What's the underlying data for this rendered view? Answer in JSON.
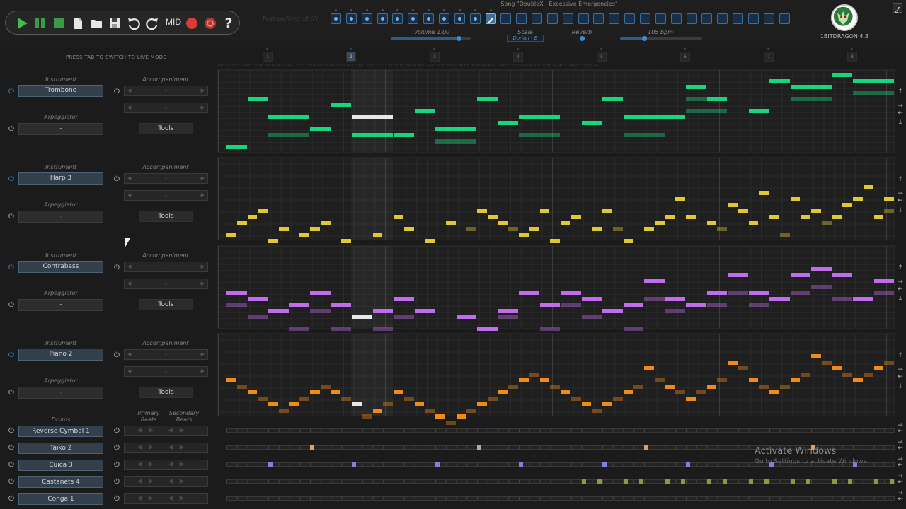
{
  "window": {
    "song_title": "Song \"DoubleX - Excessive Emergencies\"",
    "perf_text": "Post-perform off (F)"
  },
  "toolbar": {
    "mid_label": "MID"
  },
  "controls": {
    "volume_label": "Volume 1.00",
    "volume": 0.85,
    "scale_label": "Scale",
    "scale_value": "Dorian - B",
    "reverb_label": "Reverb",
    "bpm_label": "105 bpm",
    "bpm": 0.29
  },
  "patterns": {
    "count": 30,
    "active": 10,
    "selected": 10
  },
  "logo": {
    "text": "1BITDRAGON 4.3"
  },
  "tab_hint": "PRESS TAB TO SWITCH TO LIVE MODE",
  "markers": [
    "1",
    "2",
    "3",
    "4",
    "5",
    "6",
    "7",
    "8"
  ],
  "ruler": "A4 C5 D5 E5 G5 A5 C6 D6 E6 G6 A6 C7 A4 C5 D5 E5 G5 A5 C6 D6 E6 G6 A6 C7 A4 C5 D5 E5 G5 A5 C6 D6 E6 G6 A6 C7 A4 C5 D5 E5 G5 A5 C6 D6 E6 G6 A6 C7 A4 C5 D5 E5 G5 A5 C6 D6 E6 G6 A6 C7 A4 C5 D5 E5 G5",
  "track_labels": {
    "instrument": "Instrument",
    "accompaniment": "Accompaniment",
    "arpeggiator": "Arpeggiator",
    "tools": "Tools",
    "dash": "-"
  },
  "tracks": [
    {
      "instrument": "Trombone",
      "arp": "-",
      "acc1": "-",
      "acc2": "-"
    },
    {
      "instrument": "Harp 3",
      "arp": "-",
      "acc1": "-",
      "acc2": "-"
    },
    {
      "instrument": "Contrabass",
      "arp": "-",
      "acc1": "-",
      "acc2": "-"
    },
    {
      "instrument": "Piano 2",
      "arp": "-",
      "acc1": "-",
      "acc2": "-"
    }
  ],
  "colors": {
    "t1": "#16d67e",
    "t2": "#e0c832",
    "t3": "#c06cec",
    "t4": "#f08a18",
    "c1": "#d8a070",
    "c2": "#8080e0",
    "c3": "#8a9a3e"
  },
  "drums": {
    "header": "Drums",
    "primary": "Primary Beats",
    "secondary": "Secondary Beats",
    "rows": [
      {
        "name": "Reverse Cymbal 1",
        "hits": []
      },
      {
        "name": "Taiko 2",
        "hits": [
          8,
          24,
          40,
          56
        ],
        "color": "c1"
      },
      {
        "name": "Cuica 3",
        "hits": [
          4,
          12,
          20,
          28,
          36,
          44,
          52,
          60
        ],
        "color": "c2"
      },
      {
        "name": "Castanets 4",
        "hits": [
          34,
          35.5,
          38,
          39.5,
          42,
          43.5,
          46,
          47.5,
          50,
          51.5,
          54,
          55.5,
          58,
          59.5,
          62,
          63.5
        ],
        "color": "c3"
      },
      {
        "name": "Conga 1",
        "hits": []
      }
    ]
  },
  "watermark": {
    "title": "Activate Windows",
    "sub": "Go to Settings to activate Windows."
  },
  "notes": [
    [
      [
        0,
        2,
        12,
        0
      ],
      [
        2,
        2,
        4,
        0
      ],
      [
        4,
        4,
        7,
        0
      ],
      [
        4,
        4,
        10,
        1
      ],
      [
        8,
        2,
        9,
        0
      ],
      [
        10,
        2,
        5,
        0
      ],
      [
        12,
        4,
        7,
        2
      ],
      [
        12,
        4,
        10,
        3
      ],
      [
        16,
        2,
        10,
        0
      ],
      [
        18,
        2,
        6,
        0
      ],
      [
        20,
        4,
        9,
        0
      ],
      [
        20,
        4,
        11,
        1
      ],
      [
        24,
        2,
        4,
        0
      ],
      [
        26,
        2,
        8,
        0
      ],
      [
        28,
        4,
        7,
        0
      ],
      [
        28,
        4,
        10,
        1
      ],
      [
        34,
        2,
        8,
        0
      ],
      [
        36,
        2,
        4,
        0
      ],
      [
        38,
        4,
        7,
        0
      ],
      [
        38,
        4,
        10,
        1
      ],
      [
        42,
        2,
        7,
        0
      ],
      [
        44,
        2,
        2,
        0
      ],
      [
        46,
        2,
        4,
        0
      ],
      [
        44,
        4,
        4,
        1
      ],
      [
        44,
        4,
        6,
        1
      ],
      [
        50,
        2,
        6,
        0
      ],
      [
        52,
        2,
        1,
        0
      ],
      [
        54,
        4,
        2,
        0
      ],
      [
        54,
        4,
        4,
        1
      ],
      [
        58,
        2,
        0,
        0
      ],
      [
        60,
        4,
        1,
        0
      ],
      [
        60,
        4,
        3,
        1
      ]
    ],
    [
      [
        0,
        1,
        12,
        0
      ],
      [
        1,
        1,
        10,
        0
      ],
      [
        2,
        1,
        9,
        0
      ],
      [
        3,
        1,
        8,
        0
      ],
      [
        4,
        1,
        13,
        0
      ],
      [
        5,
        1,
        11,
        0
      ],
      [
        6,
        1,
        15,
        0
      ],
      [
        7,
        1,
        12,
        0
      ],
      [
        8,
        1,
        11,
        0
      ],
      [
        9,
        1,
        10,
        0
      ],
      [
        10,
        1,
        16,
        0
      ],
      [
        11,
        1,
        13,
        0
      ],
      [
        12,
        1,
        17,
        2
      ],
      [
        13,
        1,
        14,
        0
      ],
      [
        14,
        1,
        12,
        0
      ],
      [
        15,
        1,
        14,
        1
      ],
      [
        16,
        1,
        9,
        0
      ],
      [
        17,
        1,
        11,
        0
      ],
      [
        18,
        1,
        16,
        0
      ],
      [
        19,
        1,
        13,
        0
      ],
      [
        20,
        1,
        18,
        0
      ],
      [
        21,
        1,
        10,
        0
      ],
      [
        22,
        1,
        14,
        0
      ],
      [
        23,
        1,
        11,
        1
      ],
      [
        24,
        1,
        8,
        0
      ],
      [
        25,
        1,
        9,
        0
      ],
      [
        26,
        1,
        10,
        0
      ],
      [
        27,
        1,
        11,
        1
      ],
      [
        28,
        1,
        12,
        0
      ],
      [
        29,
        1,
        11,
        0
      ],
      [
        30,
        1,
        8,
        0
      ],
      [
        31,
        1,
        13,
        0
      ],
      [
        32,
        1,
        10,
        0
      ],
      [
        33,
        1,
        9,
        0
      ],
      [
        34,
        1,
        14,
        0
      ],
      [
        35,
        1,
        11,
        0
      ],
      [
        36,
        1,
        8,
        0
      ],
      [
        37,
        1,
        11,
        1
      ],
      [
        38,
        1,
        13,
        0
      ],
      [
        39,
        1,
        16,
        1
      ],
      [
        40,
        1,
        11,
        0
      ],
      [
        41,
        1,
        10,
        0
      ],
      [
        42,
        1,
        9,
        0
      ],
      [
        43,
        1,
        6,
        0
      ],
      [
        44,
        1,
        9,
        0
      ],
      [
        45,
        1,
        14,
        1
      ],
      [
        46,
        1,
        10,
        0
      ],
      [
        47,
        1,
        11,
        1
      ],
      [
        48,
        1,
        7,
        0
      ],
      [
        49,
        1,
        8,
        0
      ],
      [
        50,
        1,
        10,
        0
      ],
      [
        51,
        1,
        5,
        0
      ],
      [
        52,
        1,
        9,
        0
      ],
      [
        53,
        1,
        12,
        1
      ],
      [
        54,
        1,
        6,
        0
      ],
      [
        55,
        1,
        9,
        0
      ],
      [
        56,
        1,
        8,
        0
      ],
      [
        57,
        1,
        10,
        1
      ],
      [
        58,
        1,
        9,
        0
      ],
      [
        59,
        1,
        7,
        0
      ],
      [
        60,
        1,
        6,
        0
      ],
      [
        61,
        1,
        4,
        0
      ],
      [
        62,
        1,
        9,
        0
      ],
      [
        63,
        1,
        6,
        0
      ],
      [
        63,
        1,
        8,
        1
      ]
    ],
    [
      [
        0,
        2,
        7,
        0
      ],
      [
        0,
        2,
        9,
        1
      ],
      [
        2,
        2,
        8,
        0
      ],
      [
        2,
        2,
        11,
        1
      ],
      [
        4,
        2,
        10,
        0
      ],
      [
        6,
        2,
        9,
        0
      ],
      [
        6,
        2,
        13,
        1
      ],
      [
        8,
        2,
        7,
        0
      ],
      [
        8,
        2,
        10,
        1
      ],
      [
        10,
        2,
        9,
        0
      ],
      [
        10,
        2,
        13,
        1
      ],
      [
        12,
        2,
        11,
        2
      ],
      [
        14,
        2,
        10,
        0
      ],
      [
        14,
        2,
        13,
        1
      ],
      [
        16,
        2,
        8,
        0
      ],
      [
        16,
        2,
        11,
        1
      ],
      [
        18,
        2,
        10,
        0
      ],
      [
        20,
        2,
        14,
        0
      ],
      [
        20,
        2,
        15,
        1
      ],
      [
        22,
        2,
        11,
        0
      ],
      [
        22,
        2,
        15,
        1
      ],
      [
        24,
        2,
        13,
        0
      ],
      [
        24,
        2,
        15,
        1
      ],
      [
        26,
        2,
        10,
        0
      ],
      [
        26,
        2,
        11,
        1
      ],
      [
        28,
        2,
        7,
        0
      ],
      [
        30,
        2,
        9,
        0
      ],
      [
        30,
        2,
        13,
        1
      ],
      [
        32,
        2,
        7,
        0
      ],
      [
        32,
        2,
        9,
        1
      ],
      [
        34,
        2,
        8,
        0
      ],
      [
        34,
        2,
        11,
        1
      ],
      [
        36,
        2,
        10,
        0
      ],
      [
        38,
        2,
        9,
        0
      ],
      [
        38,
        2,
        13,
        1
      ],
      [
        40,
        2,
        5,
        0
      ],
      [
        40,
        2,
        8,
        1
      ],
      [
        42,
        2,
        8,
        0
      ],
      [
        42,
        2,
        10,
        1
      ],
      [
        44,
        2,
        9,
        0
      ],
      [
        46,
        2,
        7,
        0
      ],
      [
        46,
        2,
        9,
        1
      ],
      [
        48,
        2,
        4,
        0
      ],
      [
        48,
        2,
        7,
        1
      ],
      [
        50,
        2,
        7,
        0
      ],
      [
        50,
        2,
        9,
        1
      ],
      [
        52,
        2,
        8,
        0
      ],
      [
        54,
        2,
        4,
        0
      ],
      [
        54,
        2,
        7,
        1
      ],
      [
        56,
        2,
        3,
        0
      ],
      [
        56,
        2,
        6,
        1
      ],
      [
        58,
        2,
        4,
        0
      ],
      [
        58,
        2,
        8,
        1
      ],
      [
        60,
        2,
        8,
        0
      ],
      [
        62,
        2,
        5,
        0
      ],
      [
        62,
        2,
        7,
        1
      ]
    ],
    [
      [
        0,
        1,
        7,
        0
      ],
      [
        1,
        1,
        8,
        1
      ],
      [
        2,
        1,
        9,
        0
      ],
      [
        3,
        1,
        10,
        1
      ],
      [
        4,
        1,
        11,
        0
      ],
      [
        5,
        1,
        12,
        1
      ],
      [
        6,
        1,
        11,
        0
      ],
      [
        7,
        1,
        10,
        1
      ],
      [
        8,
        1,
        9,
        0
      ],
      [
        9,
        1,
        8,
        1
      ],
      [
        10,
        1,
        9,
        0
      ],
      [
        11,
        1,
        10,
        1
      ],
      [
        12,
        1,
        11,
        2
      ],
      [
        13,
        1,
        13,
        1
      ],
      [
        14,
        1,
        12,
        0
      ],
      [
        15,
        1,
        11,
        1
      ],
      [
        16,
        1,
        9,
        0
      ],
      [
        17,
        1,
        10,
        1
      ],
      [
        18,
        1,
        11,
        0
      ],
      [
        19,
        1,
        12,
        1
      ],
      [
        20,
        1,
        13,
        0
      ],
      [
        21,
        1,
        14,
        1
      ],
      [
        22,
        1,
        13,
        0
      ],
      [
        23,
        1,
        12,
        1
      ],
      [
        24,
        1,
        11,
        0
      ],
      [
        25,
        1,
        10,
        1
      ],
      [
        26,
        1,
        9,
        0
      ],
      [
        27,
        1,
        8,
        1
      ],
      [
        28,
        1,
        7,
        0
      ],
      [
        29,
        1,
        6,
        1
      ],
      [
        30,
        1,
        7,
        0
      ],
      [
        31,
        1,
        8,
        1
      ],
      [
        32,
        1,
        9,
        0
      ],
      [
        33,
        1,
        10,
        1
      ],
      [
        34,
        1,
        11,
        0
      ],
      [
        35,
        1,
        12,
        1
      ],
      [
        36,
        1,
        11,
        0
      ],
      [
        37,
        1,
        10,
        1
      ],
      [
        38,
        1,
        9,
        0
      ],
      [
        39,
        1,
        8,
        1
      ],
      [
        40,
        1,
        5,
        0
      ],
      [
        41,
        1,
        7,
        1
      ],
      [
        42,
        1,
        8,
        0
      ],
      [
        43,
        1,
        9,
        1
      ],
      [
        44,
        1,
        10,
        0
      ],
      [
        45,
        1,
        9,
        1
      ],
      [
        46,
        1,
        8,
        0
      ],
      [
        47,
        1,
        7,
        1
      ],
      [
        48,
        1,
        4,
        0
      ],
      [
        49,
        1,
        5,
        1
      ],
      [
        50,
        1,
        7,
        0
      ],
      [
        51,
        1,
        8,
        1
      ],
      [
        52,
        1,
        9,
        0
      ],
      [
        53,
        1,
        8,
        1
      ],
      [
        54,
        1,
        7,
        0
      ],
      [
        55,
        1,
        6,
        1
      ],
      [
        56,
        1,
        3,
        0
      ],
      [
        57,
        1,
        4,
        1
      ],
      [
        58,
        1,
        5,
        0
      ],
      [
        59,
        1,
        6,
        1
      ],
      [
        60,
        1,
        7,
        0
      ],
      [
        61,
        1,
        6,
        1
      ],
      [
        62,
        1,
        5,
        0
      ],
      [
        63,
        1,
        4,
        1
      ]
    ]
  ]
}
